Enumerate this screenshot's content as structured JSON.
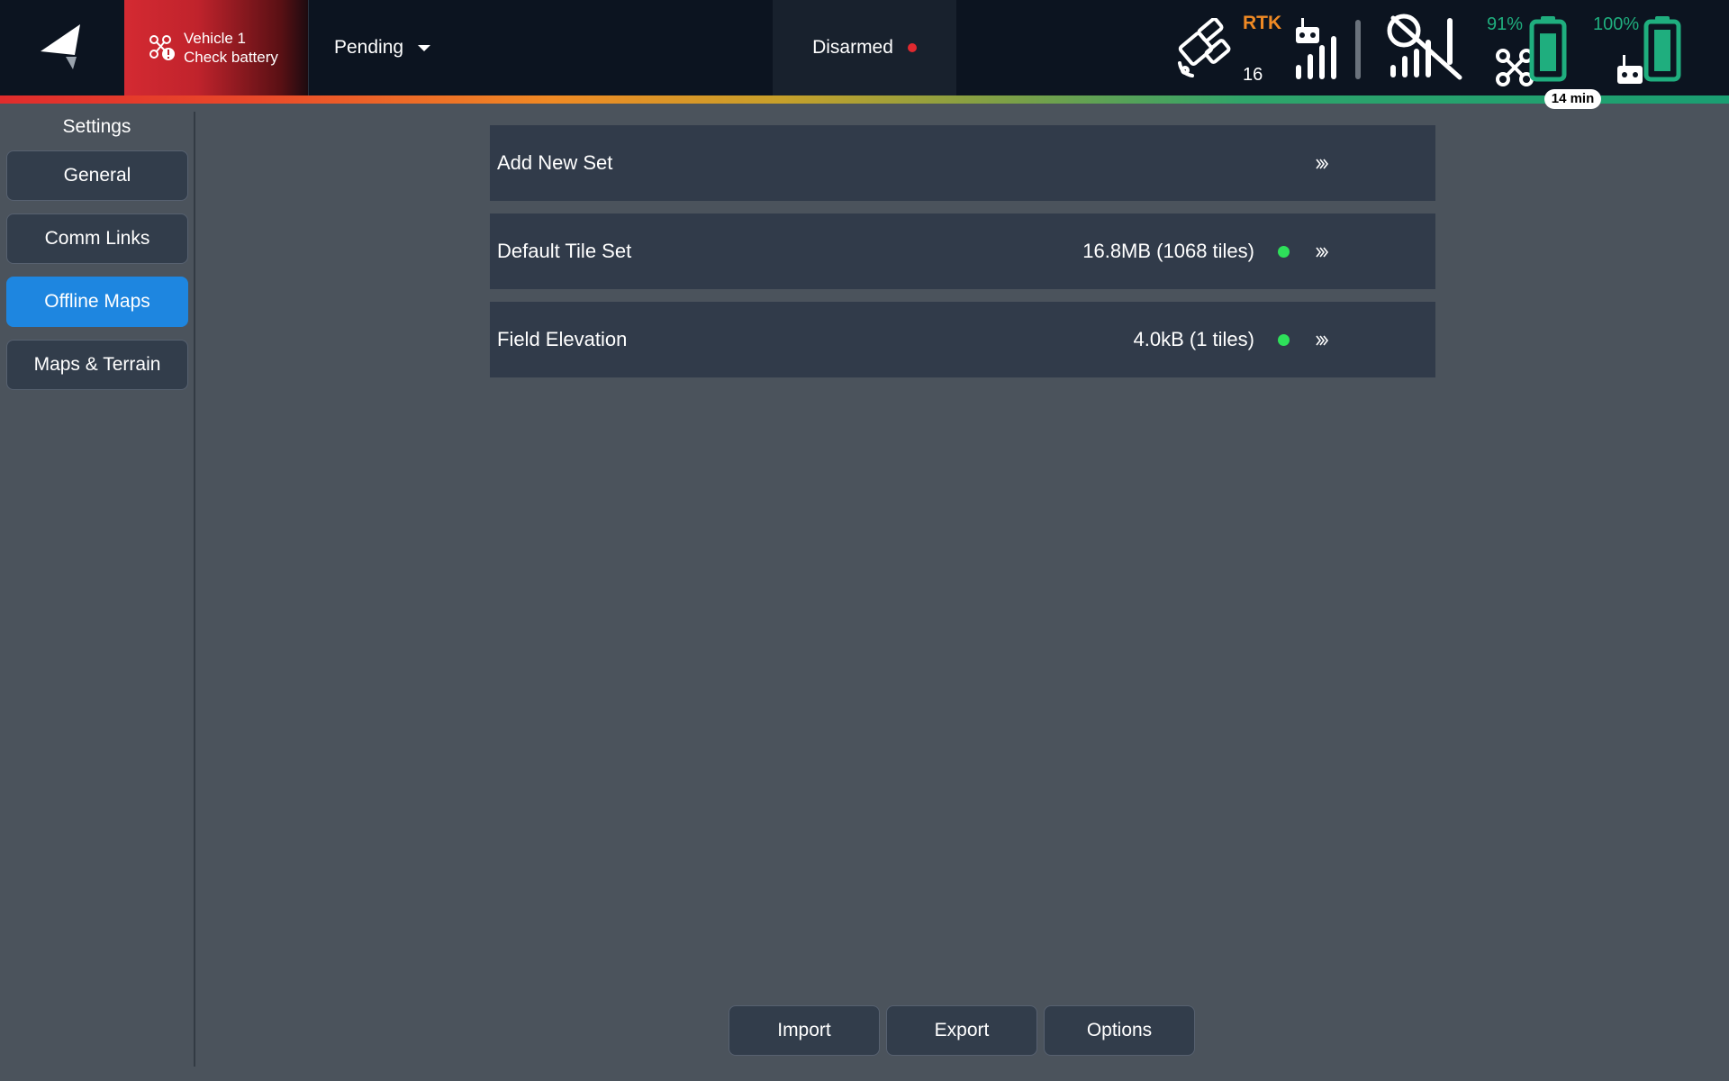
{
  "toolbar": {
    "vehicle": {
      "line1": "Vehicle 1",
      "line2": "Check battery",
      "icon": "drone-warning-icon"
    },
    "flight_mode": "Pending",
    "arm_status": "Disarmed",
    "gps": {
      "fix_label": "RTK",
      "satellite_count": "16"
    },
    "flight_battery": {
      "percent_label": "91%",
      "level": 0.91
    },
    "rc_battery": {
      "percent_label": "100%",
      "level": 1.0
    },
    "remaining_time": "14 min",
    "colors": {
      "accent_green": "#1fae7e",
      "rtk_orange": "#f08a24",
      "alert_red": "#d42a32"
    }
  },
  "sidebar": {
    "title": "Settings",
    "items": [
      {
        "label": "General",
        "active": false
      },
      {
        "label": "Comm Links",
        "active": false
      },
      {
        "label": "Offline Maps",
        "active": true
      },
      {
        "label": "Maps & Terrain",
        "active": false
      }
    ]
  },
  "tile_sets": [
    {
      "name": "Add New Set",
      "size": "",
      "has_status": false
    },
    {
      "name": "Default Tile Set",
      "size": "16.8MB (1068 tiles)",
      "has_status": true
    },
    {
      "name": "Field Elevation",
      "size": "4.0kB (1 tiles)",
      "has_status": true
    }
  ],
  "actions": {
    "import_label": "Import",
    "export_label": "Export",
    "options_label": "Options"
  }
}
